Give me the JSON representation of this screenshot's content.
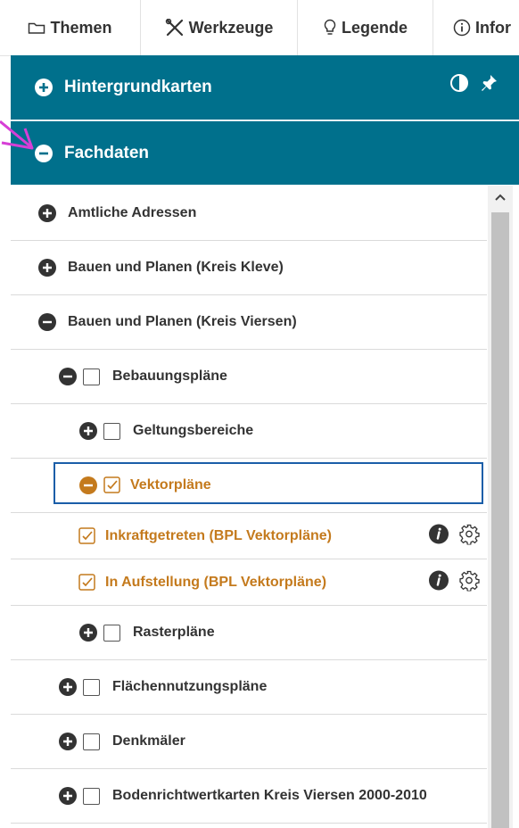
{
  "tabs": [
    {
      "label": "Themen",
      "icon": "folder-icon"
    },
    {
      "label": "Werkzeuge",
      "icon": "tools-icon"
    },
    {
      "label": "Legende",
      "icon": "lightbulb-icon"
    },
    {
      "label": "Infor",
      "icon": "info-circle-icon"
    }
  ],
  "headers": {
    "hintergrund": {
      "label": "Hintergrundkarten",
      "state": "collapsed"
    },
    "fachdaten": {
      "label": "Fachdaten",
      "state": "expanded"
    }
  },
  "tree": [
    {
      "label": "Amtliche Adressen",
      "state": "collapsed",
      "checkbox": false
    },
    {
      "label": "Bauen und Planen (Kreis Kleve)",
      "state": "collapsed",
      "checkbox": false
    },
    {
      "label": "Bauen und Planen (Kreis Viersen)",
      "state": "expanded",
      "checkbox": false
    },
    {
      "label": "Bebauungspläne",
      "state": "expanded",
      "checkbox": true,
      "checked": false
    },
    {
      "label": "Geltungsbereiche",
      "state": "collapsed",
      "checkbox": true,
      "checked": false
    },
    {
      "label": "Vektorpläne",
      "state": "expanded",
      "checkbox": true,
      "checked": true,
      "selected": true
    },
    {
      "label": "Inkraftgetreten (BPL Vektorpläne)",
      "checkbox": true,
      "checked": true,
      "layer": true
    },
    {
      "label": "In Aufstellung (BPL Vektorpläne)",
      "checkbox": true,
      "checked": true,
      "layer": true
    },
    {
      "label": "Rasterpläne",
      "state": "collapsed",
      "checkbox": true,
      "checked": false
    },
    {
      "label": "Flächennutzungspläne",
      "state": "collapsed",
      "checkbox": true,
      "checked": false
    },
    {
      "label": "Denkmäler",
      "state": "collapsed",
      "checkbox": true,
      "checked": false
    },
    {
      "label": "Bodenrichtwertkarten Kreis Viersen 2000-2010",
      "state": "collapsed",
      "checkbox": true,
      "checked": false
    }
  ],
  "colors": {
    "header_bg": "#00708c",
    "active_orange": "#c47a1d",
    "selection_border": "#1a5ea8",
    "annotation_arrow": "#d63fd6"
  }
}
